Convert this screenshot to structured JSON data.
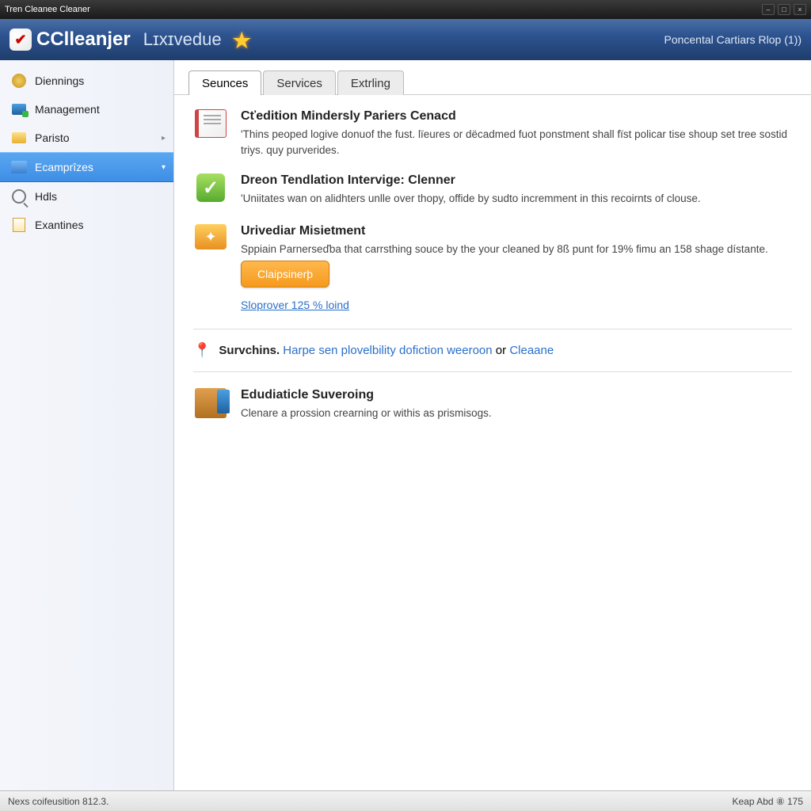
{
  "titlebar": {
    "title": "Tren Cleanee Cleaner"
  },
  "banner": {
    "appname": "CClleanjer",
    "subname": "Lɪxɪvedue",
    "right": "Poncental Cartiars Rlop (1))"
  },
  "sidebar": {
    "items": [
      {
        "label": "Diennings",
        "icon": "disk"
      },
      {
        "label": "Management",
        "icon": "mgmt"
      },
      {
        "label": "Paristo",
        "icon": "folder",
        "chevron": true
      },
      {
        "label": "Ecamprîzes",
        "icon": "blue",
        "active": true
      },
      {
        "label": "Hdls",
        "icon": "mag"
      },
      {
        "label": "Exantines",
        "icon": "doc"
      }
    ]
  },
  "tabs": [
    {
      "label": "Seunces",
      "active": true
    },
    {
      "label": "Services",
      "active": false
    },
    {
      "label": "Extrling",
      "active": false
    }
  ],
  "blocks": {
    "b1": {
      "title": "Cťedition Mindersly Pariers Cenacd",
      "desc": "'Thins peoped logive donuof the fust. lïeures or dëcadmed fuot ponstment shall fïst policar tise shoup set tree sostid triys. quy purverides."
    },
    "b2": {
      "title": "Dreon Tendlation Intervige: Clenner",
      "desc": "'Uniitates wan on alidhters unlle over thopy, offide by sudto incremment in this recoirnts of clouse."
    },
    "b3": {
      "title": "Urivediar Misietment",
      "desc": "Sppiain Parnerseďba that carrsthing souce by the your cleaned by 8ß punt for 19% fimu an 158 shage dístante.",
      "button": "Claipsinerþ",
      "link": "Sloprover 125 % loind"
    },
    "surv": {
      "bold": "Survchins.",
      "mid": "Harpe sen plovelbility dofiction weeroon",
      "or": "or",
      "end": "Cleaane"
    },
    "b4": {
      "title": "Edudiaticle Suveroing",
      "desc": "Clenare a prossion crearning or withis as prismisogs."
    }
  },
  "status": {
    "left": "Nexs coifeusition 812.3.",
    "right": "Keap Abd ⑧ 175"
  }
}
